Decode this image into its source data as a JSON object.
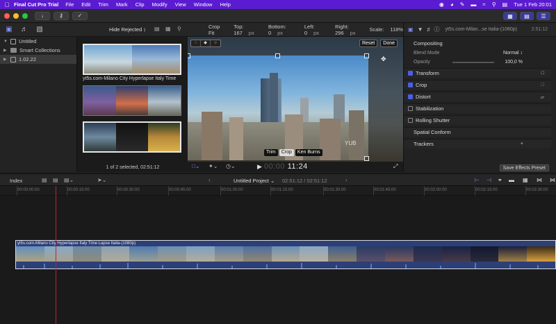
{
  "menubar": {
    "app_name": "Final Cut Pro Trial",
    "items": [
      "File",
      "Edit",
      "Trim",
      "Mark",
      "Clip",
      "Modify",
      "View",
      "Window",
      "Help"
    ],
    "clock": "Tue 1 Feb  20:01",
    "accent": "#5b1bd0"
  },
  "toolbar": {
    "import_icon": "download-icon",
    "keyword_icon": "key-icon",
    "check_icon": "checkmark-circle-icon"
  },
  "library": {
    "filter": "Hide Rejected",
    "items": [
      {
        "label": "Untitled",
        "kind": "library"
      },
      {
        "label": "Smart Collections",
        "kind": "folder"
      },
      {
        "label": "1.02.22",
        "kind": "event"
      }
    ],
    "clip_name": "yt5s.com-Milano City Hyperlapse Italy Time",
    "status": "1 of 2 selected, 02:51:12"
  },
  "viewer": {
    "mode": "Crop Fit",
    "top_label": "Top:",
    "top_value": "167",
    "bottom_label": "Bottom:",
    "bottom_value": "0",
    "left_label": "Left:",
    "left_value": "0",
    "right_label": "Right:",
    "right_value": "296",
    "unit": "px",
    "scale_label": "Scale:",
    "scale_value": "118%",
    "reset": "Reset",
    "done": "Done",
    "crop_modes": [
      "Trim",
      "Crop",
      "Ken Burns"
    ],
    "selected_crop_mode": "Crop",
    "timecode_dim": "00:00",
    "timecode": "11:24",
    "watermark": "YUB"
  },
  "inspector": {
    "clip_title": "yt5s.com-Milan...se Italia-(1080p)",
    "duration": "2:51:12",
    "compositing": "Compositing",
    "blend_mode_label": "Blend Mode",
    "blend_mode_value": "Normal ↕",
    "opacity_label": "Opacity",
    "opacity_value": "100,0 %",
    "transform": "Transform",
    "crop": "Crop",
    "distort": "Distort",
    "stabilization": "Stabilization",
    "rolling_shutter": "Rolling Shutter",
    "spatial_conform": "Spatial Conform",
    "trackers": "Trackers",
    "trackers_add": "+",
    "save_preset": "Save Effects Preset"
  },
  "timeline": {
    "index": "Index",
    "project": "Untitled Project ⌄",
    "timecode": "02:51:12 / 02:51:12",
    "ruler": [
      "00:00:00:00",
      "00:00:15:00",
      "00:00:30:00",
      "00:00:45:00",
      "00:01:00:00",
      "00:01:15:00",
      "00:01:30:00",
      "00:01:45:00",
      "00:02:00:00",
      "00:02:15:00",
      "00:02:30:00"
    ],
    "clip_label": "yt5s.com-Milano City Hyperlapse Italy Time Lapse Italia-(1080p)"
  }
}
